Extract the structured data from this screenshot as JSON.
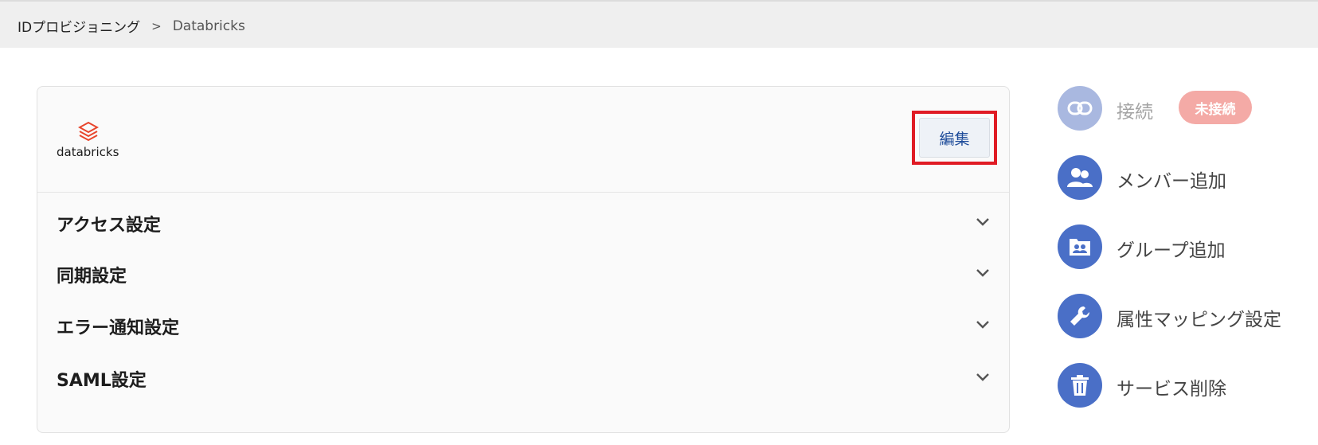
{
  "breadcrumb": {
    "parent": "IDプロビジョニング",
    "separator": ">",
    "current": "Databricks"
  },
  "service": {
    "logo_text": "databricks",
    "edit_label": "編集"
  },
  "sections": [
    {
      "label": "アクセス設定"
    },
    {
      "label": "同期設定"
    },
    {
      "label": "エラー通知設定"
    },
    {
      "label": "SAML設定"
    }
  ],
  "actions": {
    "connect": {
      "label": "接続",
      "status": "未接続",
      "icon": "link-icon"
    },
    "add_member": {
      "label": "メンバー追加",
      "icon": "users-icon"
    },
    "add_group": {
      "label": "グループ追加",
      "icon": "group-folder-icon"
    },
    "attribute_mapping": {
      "label": "属性マッピング設定",
      "icon": "wrench-icon"
    },
    "delete_service": {
      "label": "サービス削除",
      "icon": "trash-icon"
    }
  },
  "colors": {
    "accent": "#4a6fc7",
    "accent_disabled": "#a9b8e0",
    "badge": "#f4aaa6",
    "highlight": "#e01b24",
    "brand": "#e8452c"
  }
}
